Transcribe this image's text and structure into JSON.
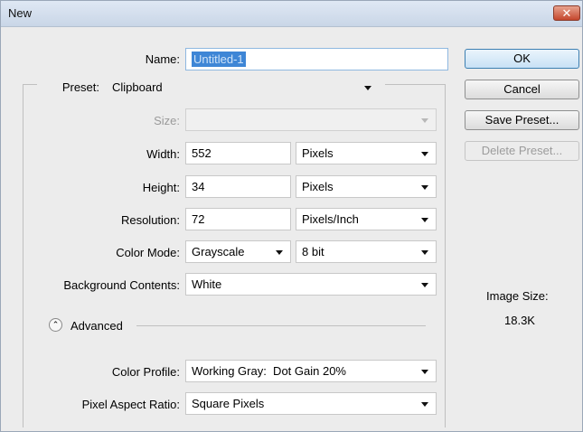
{
  "window": {
    "title": "New",
    "close_symbol": "✕"
  },
  "name": {
    "label": "Name:",
    "value": "Untitled-1"
  },
  "preset": {
    "label": "Preset:",
    "value": "Clipboard"
  },
  "size": {
    "label": "Size:",
    "value": ""
  },
  "width": {
    "label": "Width:",
    "value": "552",
    "unit": "Pixels"
  },
  "height": {
    "label": "Height:",
    "value": "34",
    "unit": "Pixels"
  },
  "resolution": {
    "label": "Resolution:",
    "value": "72",
    "unit": "Pixels/Inch"
  },
  "color_mode": {
    "label": "Color Mode:",
    "value": "Grayscale",
    "depth": "8 bit"
  },
  "background": {
    "label": "Background Contents:",
    "value": "White"
  },
  "advanced": {
    "label": "Advanced",
    "icon": "⌃"
  },
  "color_profile": {
    "label": "Color Profile:",
    "value": "Working Gray:  Dot Gain 20%"
  },
  "pixel_aspect": {
    "label": "Pixel Aspect Ratio:",
    "value": "Square Pixels"
  },
  "buttons": {
    "ok": "OK",
    "cancel": "Cancel",
    "save_preset": "Save Preset...",
    "delete_preset": "Delete Preset..."
  },
  "image_size": {
    "label": "Image Size:",
    "value": "18.3K"
  }
}
